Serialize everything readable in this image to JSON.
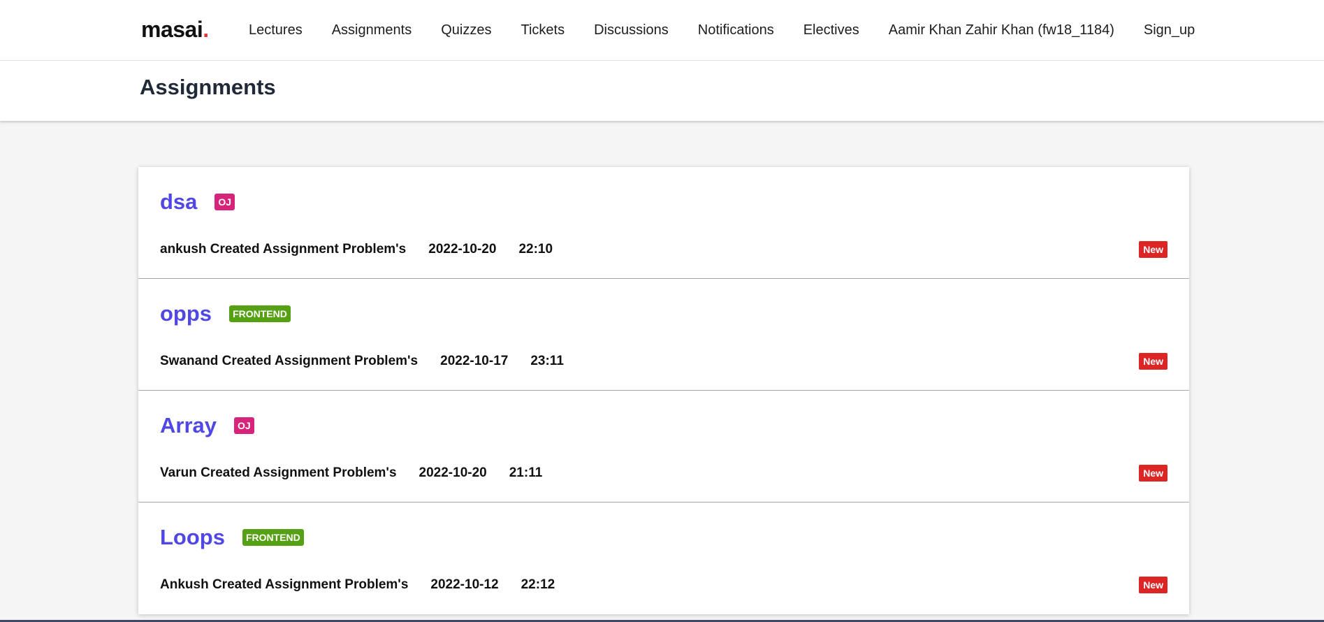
{
  "brand": {
    "name": "masai",
    "dot": "."
  },
  "nav": {
    "items": [
      {
        "label": "Lectures"
      },
      {
        "label": "Assignments"
      },
      {
        "label": "Quizzes"
      },
      {
        "label": "Tickets"
      },
      {
        "label": "Discussions"
      },
      {
        "label": "Notifications"
      },
      {
        "label": "Electives"
      },
      {
        "label": "Aamir Khan Zahir Khan (fw18_1184)"
      },
      {
        "label": "Sign_up"
      }
    ]
  },
  "page": {
    "title": "Assignments"
  },
  "assignments": [
    {
      "title": "dsa",
      "tag": "OJ",
      "author_text": "ankush Created Assignment Problem's",
      "date": "2022-10-20",
      "time": "22:10",
      "badge": "New"
    },
    {
      "title": "opps",
      "tag": "FRONTEND",
      "author_text": "Swanand Created Assignment Problem's",
      "date": "2022-10-17",
      "time": "23:11",
      "badge": "New"
    },
    {
      "title": "Array",
      "tag": "OJ",
      "author_text": "Varun Created Assignment Problem's",
      "date": "2022-10-20",
      "time": "21:11",
      "badge": "New"
    },
    {
      "title": "Loops",
      "tag": "FRONTEND",
      "author_text": "Ankush Created Assignment Problem's",
      "date": "2022-10-12",
      "time": "22:12",
      "badge": "New"
    }
  ],
  "colors": {
    "title_link": "#5147e5",
    "tag_oj": "#d6247a",
    "tag_frontend": "#55a113",
    "badge_new": "#dc2626",
    "logo_dot": "#e0313b"
  }
}
